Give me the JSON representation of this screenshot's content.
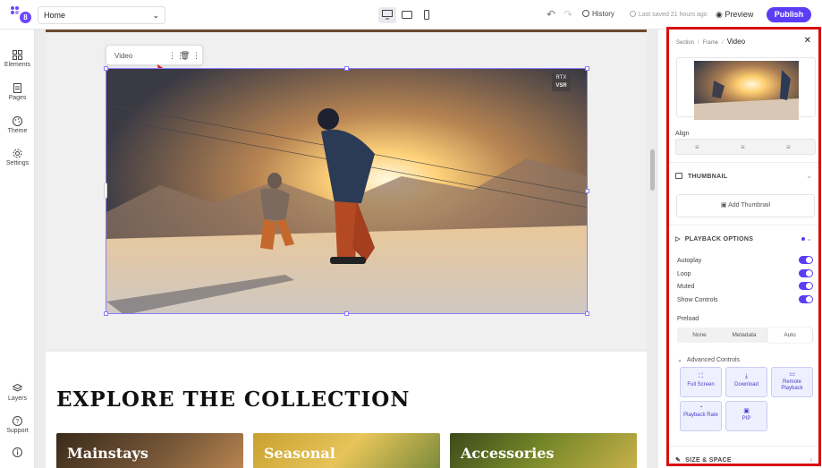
{
  "topbar": {
    "logo_number": "8",
    "page_select_value": "Home",
    "history_label": "History",
    "last_saved": "Last saved 21 hours ago",
    "preview_label": "Preview",
    "publish_label": "Publish",
    "accent_color": "#5b3df5"
  },
  "leftbar": {
    "items": [
      {
        "label": "Elements",
        "icon": "grid-icon"
      },
      {
        "label": "Pages",
        "icon": "page-icon"
      },
      {
        "label": "Theme",
        "icon": "palette-icon"
      },
      {
        "label": "Settings",
        "icon": "gear-icon"
      }
    ],
    "bottom_items": [
      {
        "label": "Layers",
        "icon": "layers-icon"
      },
      {
        "label": "Support",
        "icon": "help-icon"
      },
      {
        "label": "",
        "icon": "info-icon"
      }
    ]
  },
  "canvas": {
    "element_toolbar_label": "Video",
    "video_overlay_badge_line1": "RTX",
    "video_overlay_badge_line2": "VSR",
    "collection_title": "EXPLORE THE COLLECTION",
    "cards": [
      "Mainstays",
      "Seasonal",
      "Accessories"
    ]
  },
  "right_panel": {
    "breadcrumb": [
      "Section",
      "Frame",
      "Video"
    ],
    "align_label": "Align",
    "thumbnail_heading": "THUMBNAIL",
    "add_thumbnail_label": "Add Thumbnail",
    "playback_heading": "PLAYBACK OPTIONS",
    "toggles": [
      {
        "label": "Autoplay",
        "on": true
      },
      {
        "label": "Loop",
        "on": true
      },
      {
        "label": "Muted",
        "on": true
      },
      {
        "label": "Show Controls",
        "on": true
      }
    ],
    "preload_label": "Preload",
    "preload_options": [
      "None",
      "Metadata",
      "Auto"
    ],
    "preload_selected": "Auto",
    "advanced_label": "Advanced Controls",
    "advanced_controls": [
      {
        "label": "Full Screen",
        "icon": "fullscreen-icon"
      },
      {
        "label": "Download",
        "icon": "download-icon"
      },
      {
        "label": "Remote Playback",
        "icon": "cast-icon"
      },
      {
        "label": "Playback Rate",
        "icon": "speed-icon"
      },
      {
        "label": "PIP",
        "icon": "pip-icon"
      }
    ],
    "size_heading": "SIZE & SPACE",
    "highlight_color": "#d90f0f"
  }
}
